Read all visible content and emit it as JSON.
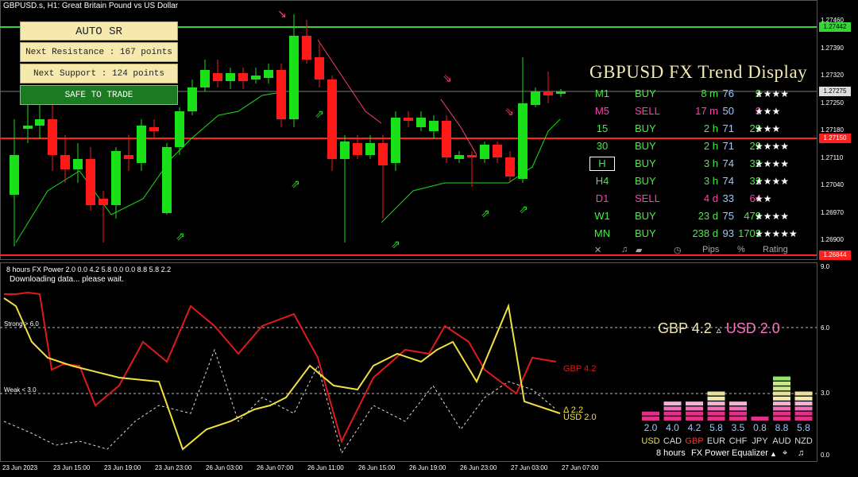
{
  "chart": {
    "title": "GBPUSD.s, H1:  Great Britain Pound vs US Dollar",
    "price_axis": [
      "1.27460",
      "1.27390",
      "1.27320",
      "1.27250",
      "1.27180",
      "1.27110",
      "1.27040",
      "1.26970",
      "1.26900"
    ],
    "price_markers": {
      "resistance": "1.27442",
      "current": "1.27275",
      "support_line": "1.27150",
      "low_line": "1.26844"
    },
    "time_axis": [
      "23 Jun 2023",
      "23 Jun 15:00",
      "23 Jun 19:00",
      "23 Jun 23:00",
      "26 Jun 03:00",
      "26 Jun 07:00",
      "26 Jun 11:00",
      "26 Jun 15:00",
      "26 Jun 19:00",
      "26 Jun 23:00",
      "27 Jun 03:00",
      "27 Jun 07:00"
    ]
  },
  "auto_sr": {
    "title": "AUTO SR",
    "resistance": "Next Resistance : 167 points",
    "support": "Next Support : 124 points",
    "status": "SAFE TO TRADE"
  },
  "trend_display": {
    "title": "GBPUSD FX Trend Display",
    "rows": [
      {
        "tf": "M1",
        "dir": "BUY",
        "age": "8 m",
        "pips": "2",
        "pct": "76",
        "stars": "★★★★"
      },
      {
        "tf": "M5",
        "dir": "SELL",
        "age": "17 m",
        "pips": "3",
        "pct": "50",
        "stars": "★★★"
      },
      {
        "tf": "15",
        "dir": "BUY",
        "age": "2 h",
        "pips": "29",
        "pct": "71",
        "stars": "★★★"
      },
      {
        "tf": "30",
        "dir": "BUY",
        "age": "2 h",
        "pips": "29",
        "pct": "71",
        "stars": "★★★★"
      },
      {
        "tf": "H",
        "dir": "BUY",
        "age": "3 h",
        "pips": "32",
        "pct": "74",
        "stars": "★★★★"
      },
      {
        "tf": "H4",
        "dir": "BUY",
        "age": "3 h",
        "pips": "32",
        "pct": "74",
        "stars": "★★★★"
      },
      {
        "tf": "D1",
        "dir": "SELL",
        "age": "4 d",
        "pips": "64",
        "pct": "33",
        "stars": "★★"
      },
      {
        "tf": "W1",
        "dir": "BUY",
        "age": "23 d",
        "pips": "479",
        "pct": "75",
        "stars": "★★★★"
      },
      {
        "tf": "MN",
        "dir": "BUY",
        "age": "238 d",
        "pips": "1703",
        "pct": "93",
        "stars": "★★★★★"
      }
    ],
    "footer": {
      "close": "✕",
      "pips": "Pips",
      "pct": "%",
      "rating": "Rating"
    }
  },
  "fx_power": {
    "title": "8 hours FX Power 2.0 0.0 4.2 5.8 0.0 0.0 8.8 5.8 2.2",
    "status": "Downloading data... please wait.",
    "levels": {
      "strong": "Strong > 6.0",
      "weak": "Weak < 3.0"
    },
    "axis": [
      "9.0",
      "6.0",
      "3.0",
      "0.0"
    ],
    "line_labels": {
      "gbp": "GBP 4.2",
      "usd": "USD 2.0",
      "delta": "Δ 2.2"
    },
    "pair": {
      "base": "GBP 4.2",
      "triangle": "▵",
      "quote": "USD 2.0"
    },
    "equalizer": {
      "currencies": [
        "USD",
        "CAD",
        "GBP",
        "EUR",
        "CHF",
        "JPY",
        "AUD",
        "NZD"
      ],
      "values": [
        2.0,
        4.0,
        4.2,
        5.8,
        3.5,
        0.8,
        8.8,
        5.8
      ],
      "value_labels": [
        "2.0",
        "4.0",
        "4.2",
        "5.8",
        "3.5",
        "0.8",
        "8.8",
        "5.8"
      ],
      "footer": {
        "period": "8 hours",
        "name": "FX Power",
        "mode": "Equalizer"
      }
    }
  },
  "colors": {
    "bull": "#19e019",
    "bear": "#ff1a1a",
    "sr_line": "#33d633",
    "resistance_line": "#ff2020",
    "gbp": "#e01a1a",
    "usd": "#f0e040"
  }
}
